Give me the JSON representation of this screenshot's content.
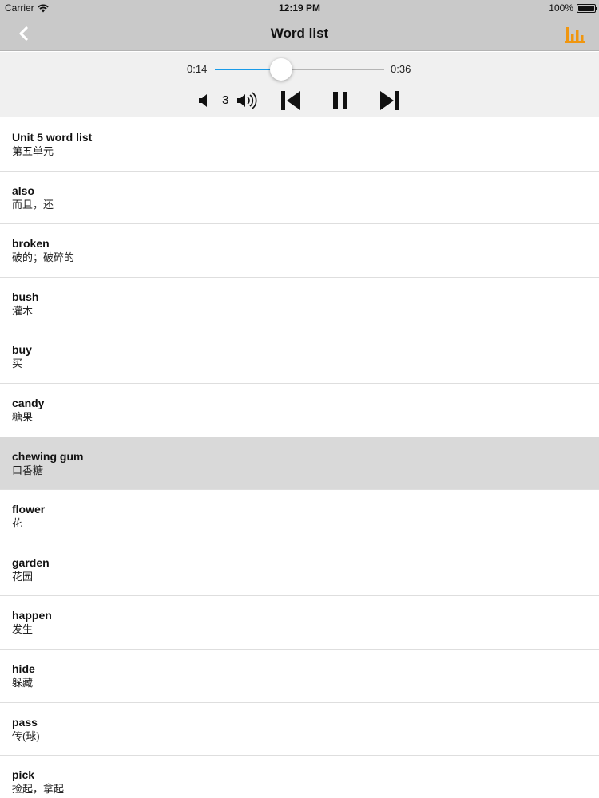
{
  "status_bar": {
    "carrier": "Carrier",
    "time": "12:19 PM",
    "battery": "100%"
  },
  "nav": {
    "title": "Word list",
    "back_icon": "chevron-left-icon",
    "chart_icon": "bar-chart-icon",
    "accent_color": "#f0960f"
  },
  "player": {
    "elapsed": "0:14",
    "total": "0:36",
    "progress_fraction": 0.39,
    "volume_level": "3",
    "progress_color": "#1a9be8"
  },
  "words": [
    {
      "en": "Unit 5 word list",
      "zh": "第五单元"
    },
    {
      "en": "also",
      "zh": "而且，还"
    },
    {
      "en": "broken",
      "zh": "破的；破碎的"
    },
    {
      "en": "bush",
      "zh": "灌木"
    },
    {
      "en": "buy",
      "zh": "买"
    },
    {
      "en": "candy",
      "zh": "糖果"
    },
    {
      "en": "chewing gum",
      "zh": "口香糖",
      "selected": true
    },
    {
      "en": "flower",
      "zh": "花"
    },
    {
      "en": "garden",
      "zh": "花园"
    },
    {
      "en": "happen",
      "zh": "发生"
    },
    {
      "en": "hide",
      "zh": "躲藏"
    },
    {
      "en": "pass",
      "zh": "传(球)"
    },
    {
      "en": "pick",
      "zh": "捡起，拿起"
    }
  ]
}
